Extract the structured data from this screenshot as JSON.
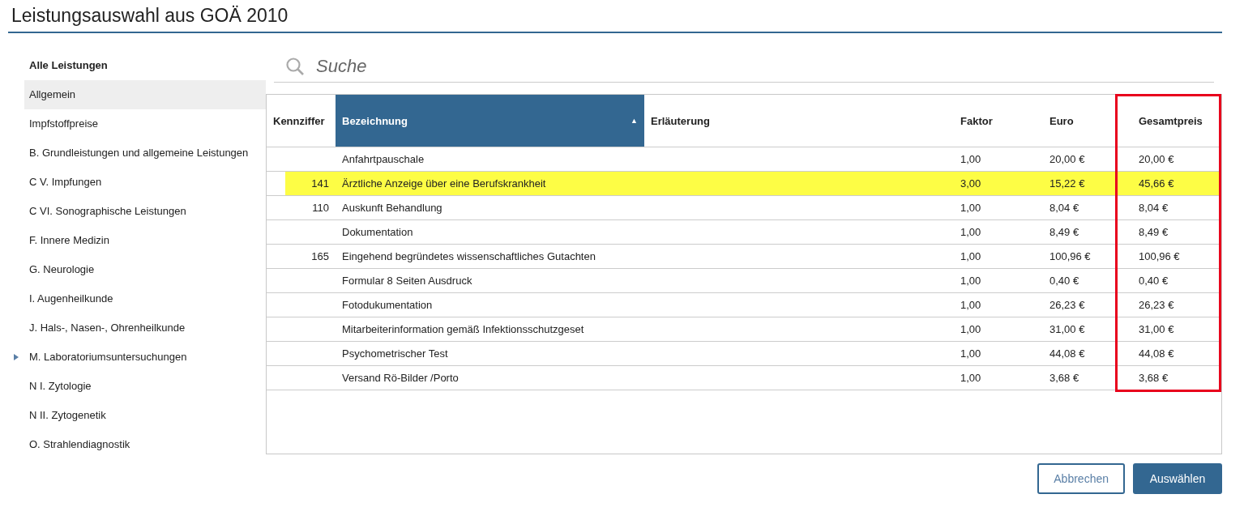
{
  "title": "Leistungsauswahl aus GOÄ 2010",
  "sidebar": {
    "heading": "Alle Leistungen",
    "items": [
      {
        "label": "Allgemein",
        "selected": true,
        "expandable": false
      },
      {
        "label": "Impfstoffpreise",
        "selected": false,
        "expandable": false
      },
      {
        "label": "B. Grundleistungen und allgemeine Leistungen",
        "selected": false,
        "expandable": false
      },
      {
        "label": "C V. Impfungen",
        "selected": false,
        "expandable": false
      },
      {
        "label": "C VI. Sonographische Leistungen",
        "selected": false,
        "expandable": false
      },
      {
        "label": "F. Innere Medizin",
        "selected": false,
        "expandable": false
      },
      {
        "label": "G. Neurologie",
        "selected": false,
        "expandable": false
      },
      {
        "label": "I. Augenheilkunde",
        "selected": false,
        "expandable": false
      },
      {
        "label": "J. Hals-, Nasen-, Ohrenheilkunde",
        "selected": false,
        "expandable": false
      },
      {
        "label": "M. Laboratoriumsuntersuchungen",
        "selected": false,
        "expandable": true
      },
      {
        "label": "N I. Zytologie",
        "selected": false,
        "expandable": false
      },
      {
        "label": "N II. Zytogenetik",
        "selected": false,
        "expandable": false
      },
      {
        "label": "O. Strahlendiagnostik",
        "selected": false,
        "expandable": false
      }
    ]
  },
  "search": {
    "placeholder": "Suche"
  },
  "table": {
    "columns": [
      {
        "label": "Kennziffer",
        "sorted": false,
        "outlined": false
      },
      {
        "label": "Bezeichnung",
        "sorted": true,
        "sort_indicator": "▲",
        "outlined": false
      },
      {
        "label": "Erläuterung",
        "sorted": false,
        "outlined": false
      },
      {
        "label": "Faktor",
        "sorted": false,
        "outlined": false
      },
      {
        "label": "Euro",
        "sorted": false,
        "outlined": false
      },
      {
        "label": "Gesamtpreis",
        "sorted": false,
        "outlined": true
      }
    ],
    "rows": [
      {
        "cells": [
          "",
          "Anfahrtpauschale",
          "",
          "1,00",
          "20,00 €",
          "20,00 €"
        ],
        "selected": false
      },
      {
        "cells": [
          "141",
          "Ärztliche Anzeige über eine Berufskrankheit",
          "",
          "3,00",
          "15,22 €",
          "45,66 €"
        ],
        "selected": true
      },
      {
        "cells": [
          "110",
          "Auskunft Behandlung",
          "",
          "1,00",
          "8,04 €",
          "8,04 €"
        ],
        "selected": false
      },
      {
        "cells": [
          "",
          "Dokumentation",
          "",
          "1,00",
          "8,49 €",
          "8,49 €"
        ],
        "selected": false
      },
      {
        "cells": [
          "165",
          "Eingehend begründetes wissenschaftliches Gutachten",
          "",
          "1,00",
          "100,96 €",
          "100,96 €"
        ],
        "selected": false
      },
      {
        "cells": [
          "",
          "Formular 8 Seiten Ausdruck",
          "",
          "1,00",
          "0,40 €",
          "0,40 €"
        ],
        "selected": false
      },
      {
        "cells": [
          "",
          "Fotodukumentation",
          "",
          "1,00",
          "26,23 €",
          "26,23 €"
        ],
        "selected": false
      },
      {
        "cells": [
          "",
          "Mitarbeiterinformation gemäß Infektionsschutzgeset",
          "",
          "1,00",
          "31,00 €",
          "31,00 €"
        ],
        "selected": false
      },
      {
        "cells": [
          "",
          "Psychometrischer Test",
          "",
          "1,00",
          "44,08 €",
          "44,08 €"
        ],
        "selected": false
      },
      {
        "cells": [
          "",
          "Versand Rö-Bilder /Porto",
          "",
          "1,00",
          "3,68 €",
          "3,68 €"
        ],
        "selected": false
      }
    ]
  },
  "buttons": [
    {
      "label": "Abbrechen",
      "kind": "secondary"
    },
    {
      "label": "Auswählen",
      "kind": "primary"
    }
  ]
}
